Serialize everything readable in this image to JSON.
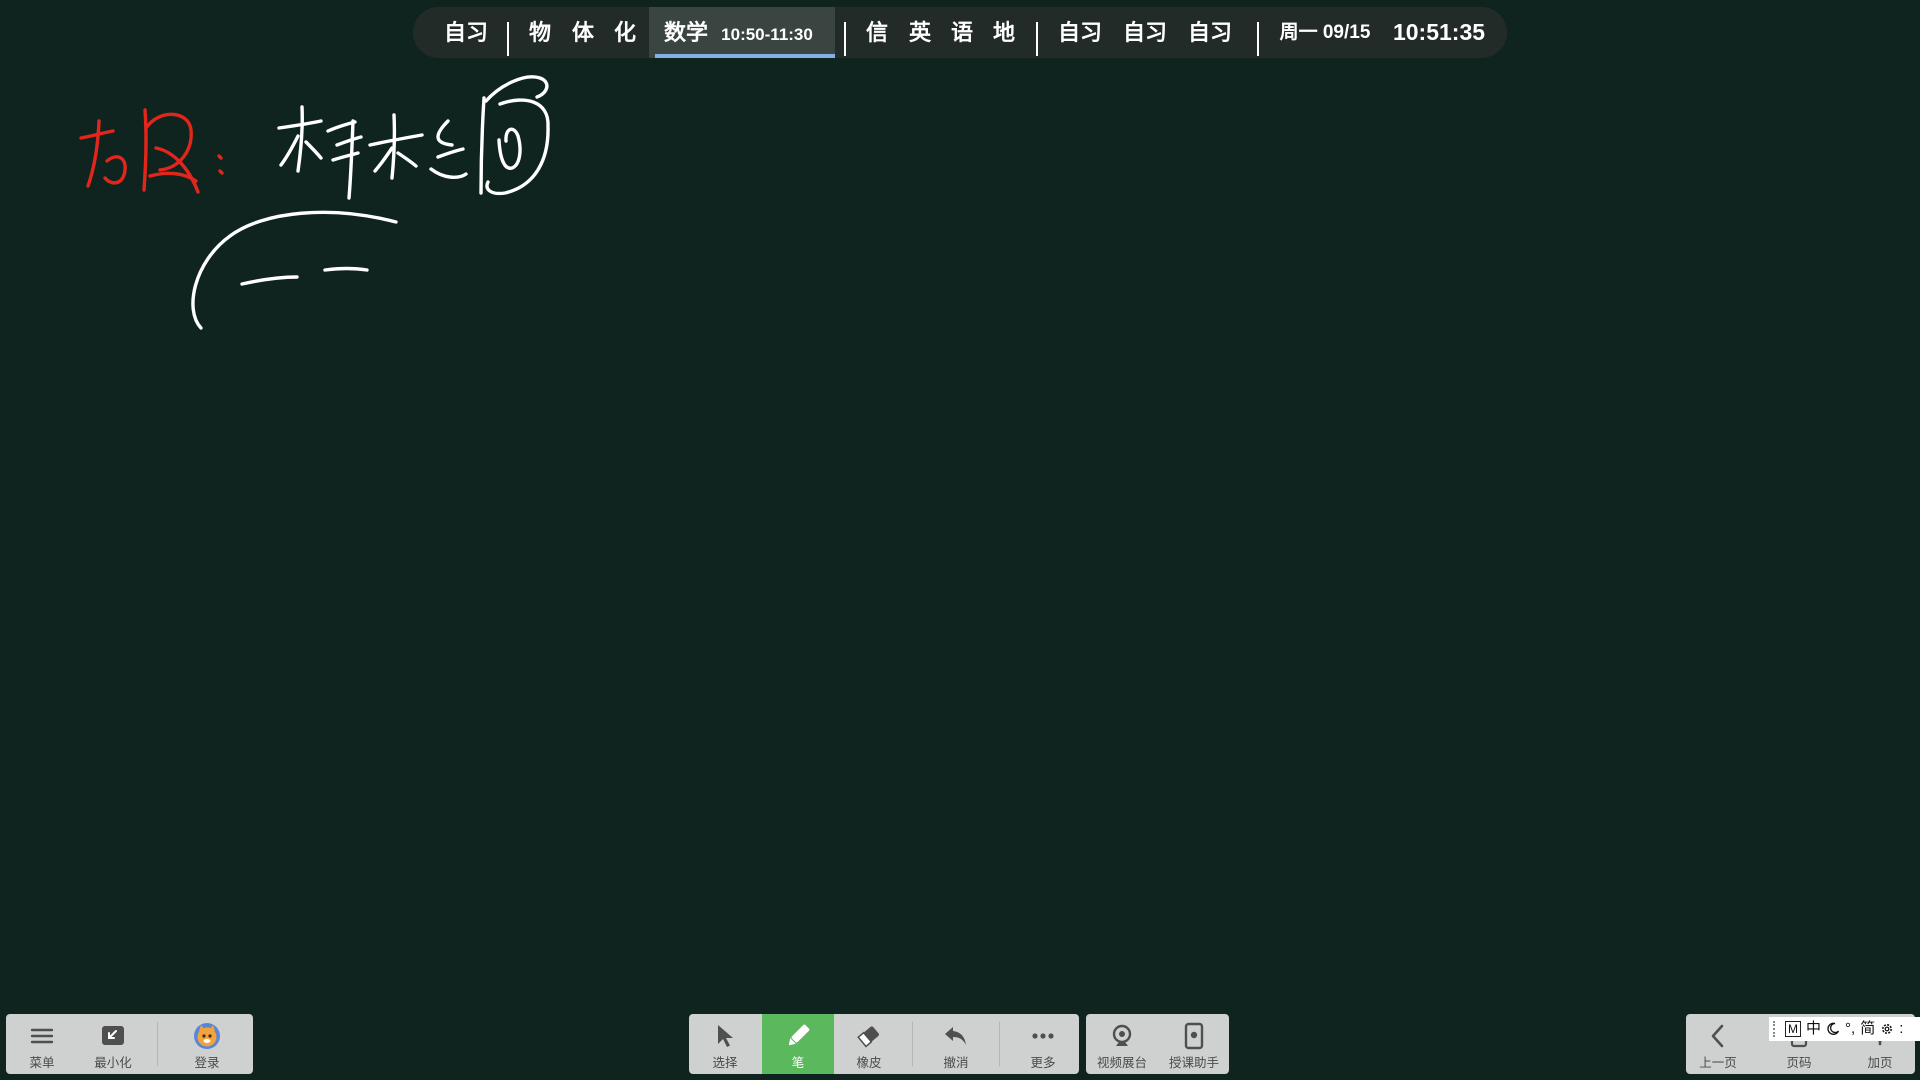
{
  "schedule": {
    "first": [
      "自习"
    ],
    "morning": [
      "物",
      "体",
      "化"
    ],
    "current": {
      "subject": "数学",
      "time": "10:50-11:30"
    },
    "afternoon": [
      "信",
      "英",
      "语",
      "地"
    ],
    "evening": [
      "自习",
      "自习",
      "自习"
    ],
    "date": "周一 09/15",
    "clock": "10:51:35"
  },
  "left_toolbar": {
    "items": [
      {
        "label": "菜单",
        "icon": "menu-icon"
      },
      {
        "label": "最小化",
        "icon": "minimize-icon"
      },
      {
        "label": "登录",
        "icon": "avatar-icon"
      }
    ]
  },
  "tool_toolbar": {
    "items": [
      {
        "label": "选择",
        "icon": "cursor-icon"
      },
      {
        "label": "笔",
        "icon": "pen-icon",
        "active": true
      },
      {
        "label": "橡皮",
        "icon": "eraser-icon"
      },
      {
        "label": "撤消",
        "icon": "undo-icon"
      },
      {
        "label": "更多",
        "icon": "more-icon"
      }
    ]
  },
  "extra_toolbar": {
    "items": [
      {
        "label": "视频展台",
        "icon": "webcam-icon"
      },
      {
        "label": "授课助手",
        "icon": "phone-assistant-icon"
      }
    ]
  },
  "page_toolbar": {
    "items": [
      {
        "label": "上一页",
        "icon": "chevron-left-icon"
      },
      {
        "label": "页码",
        "icon": "page-icon"
      },
      {
        "label": "加页",
        "icon": "add-page-icon"
      }
    ]
  },
  "ime_bar": {
    "mode_letter": "M",
    "lang": "中",
    "punct": "°,",
    "charset": "简",
    "extra": ":",
    "icons": [
      "moon-icon",
      "gear-icon"
    ]
  },
  "colors": {
    "board": "#0f241e",
    "pill": "#232b28",
    "highlight": "#3a4541",
    "accent_underline": "#86aee8",
    "toolbar": "#cfd1d0",
    "active_tool": "#5cb85c",
    "ink_red": "#e3261c",
    "ink_white": "#ffffff"
  }
}
